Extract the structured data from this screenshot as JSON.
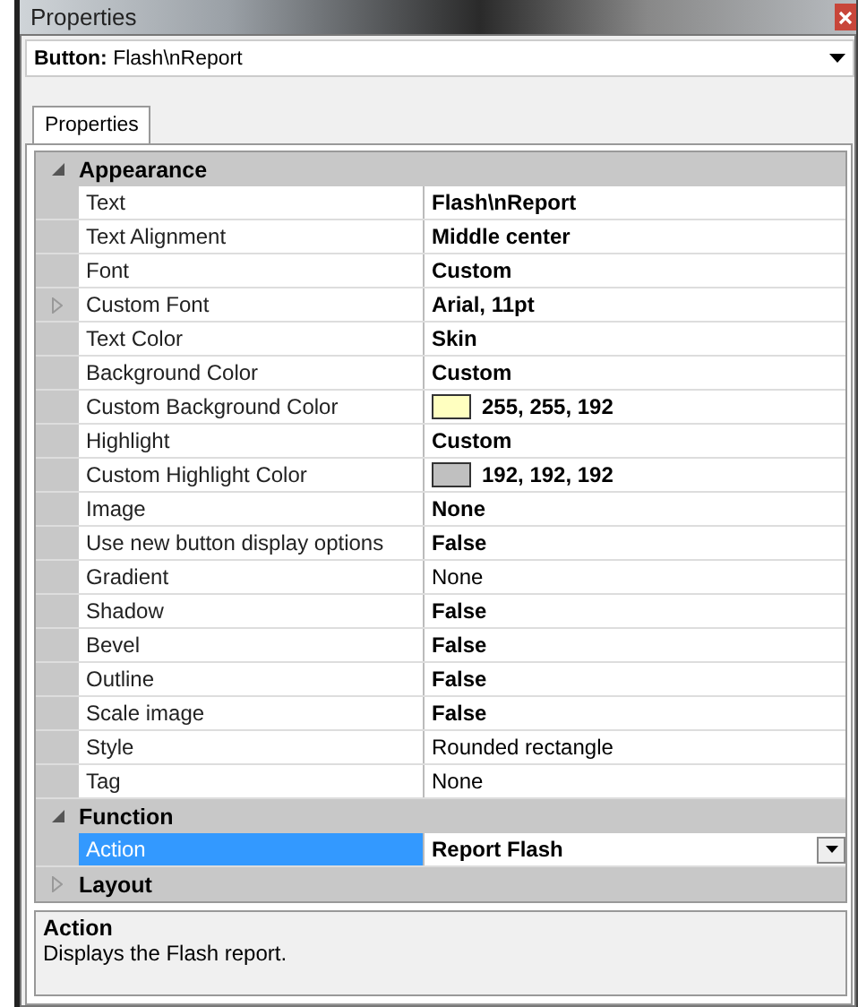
{
  "window": {
    "title": "Properties"
  },
  "object_selector": {
    "value": "**Button:** Flash\\nReport"
  },
  "tabs": [
    {
      "label": "Properties",
      "selected": true
    }
  ],
  "groups": [
    {
      "name": "Appearance",
      "expanded": true,
      "rows": [
        {
          "name": "Text",
          "value": "Flash\\nReport",
          "bold": true,
          "selected": false
        },
        {
          "name": "Text Alignment",
          "value": "Middle center",
          "bold": true,
          "selected": false
        },
        {
          "name": "Font",
          "value": "Custom",
          "bold": true,
          "selected": false
        },
        {
          "name": "Custom Font",
          "value": "Arial, 11pt",
          "bold": true,
          "selected": false,
          "expanded": false
        },
        {
          "name": "Text Color",
          "value": "Skin",
          "bold": true,
          "selected": false
        },
        {
          "name": "Background Color",
          "value": "Custom",
          "bold": true,
          "selected": false
        },
        {
          "name": "Custom Background Color",
          "value": "255, 255, 192",
          "bold": true,
          "selected": false,
          "color": "#ffffc0"
        },
        {
          "name": "Highlight",
          "value": "Custom",
          "bold": true,
          "selected": false
        },
        {
          "name": "Custom Highlight Color",
          "value": "192, 192, 192",
          "bold": true,
          "selected": false,
          "color": "#c0c0c0"
        },
        {
          "name": "Image",
          "value": "None",
          "bold": true,
          "selected": false
        },
        {
          "name": "Use new button display options",
          "value": "False",
          "bold": true,
          "selected": false
        },
        {
          "name": "Gradient",
          "value": "None",
          "bold": false,
          "selected": false
        },
        {
          "name": "Shadow",
          "value": "False",
          "bold": true,
          "selected": false
        },
        {
          "name": "Bevel",
          "value": "False",
          "bold": true,
          "selected": false
        },
        {
          "name": "Outline",
          "value": "False",
          "bold": true,
          "selected": false
        },
        {
          "name": "Scale image",
          "value": "False",
          "bold": true,
          "selected": false
        },
        {
          "name": "Style",
          "value": "Rounded rectangle",
          "bold": false,
          "selected": false
        },
        {
          "name": "Tag",
          "value": "None",
          "bold": false,
          "selected": false
        }
      ]
    },
    {
      "name": "Function",
      "expanded": true,
      "rows": [
        {
          "name": "Action",
          "value": "Report Flash",
          "bold": true,
          "selected": true
        }
      ]
    },
    {
      "name": "Layout",
      "expanded": false
    }
  ],
  "description": {
    "title": "Action",
    "text": "Displays the Flash report."
  }
}
